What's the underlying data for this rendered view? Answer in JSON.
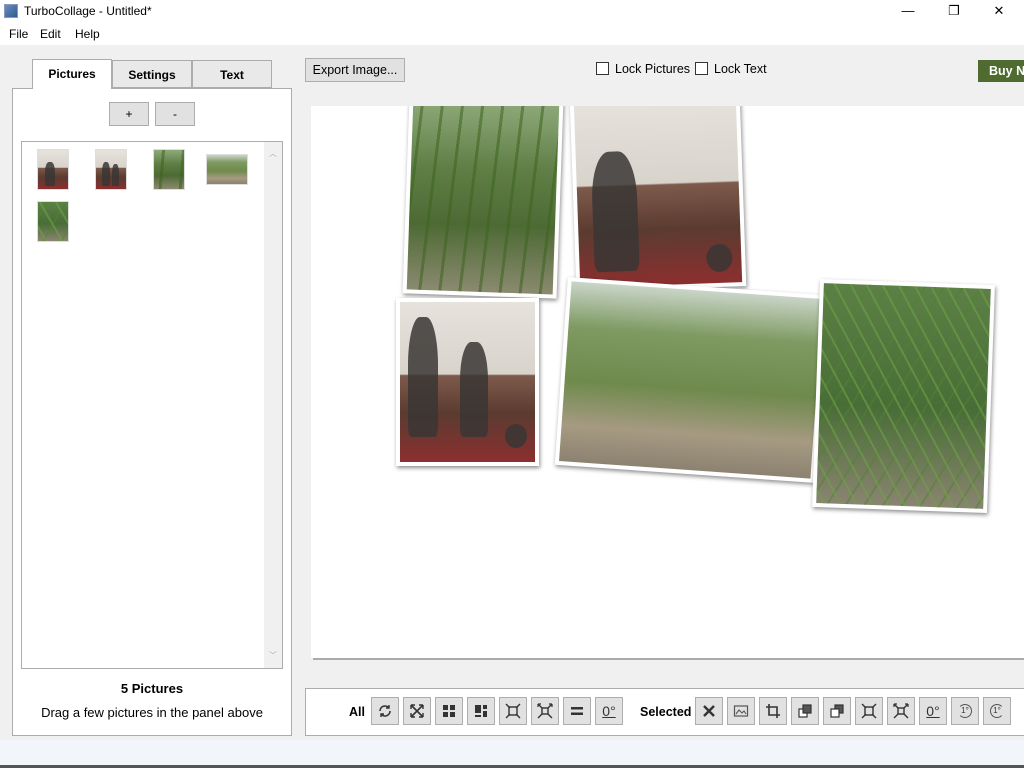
{
  "window": {
    "title": "TurboCollage - Untitled*",
    "minimize": "—",
    "restore": "❐",
    "close": "✕"
  },
  "menu": [
    "File",
    "Edit",
    "Help"
  ],
  "tabs": [
    "Pictures",
    "Settings",
    "Text"
  ],
  "panel": {
    "add_label": "+",
    "remove_label": "-",
    "picture_count": "5 Pictures",
    "hint": "Drag a few pictures in the panel above"
  },
  "top": {
    "export_label": "Export Image...",
    "lock_pictures": "Lock Pictures",
    "lock_text": "Lock Text",
    "buy_label": "Buy Now"
  },
  "toolbar": {
    "all_label": "All",
    "selected_label": "Selected",
    "all_tools": [
      "shuffle-icon",
      "fit-all-icon",
      "grid-icon",
      "mosaic-icon",
      "expand-icon",
      "shrink-icon",
      "equal-icon",
      "zero-rotation-icon"
    ],
    "selected_tools": [
      "delete-icon",
      "image-icon",
      "crop-icon",
      "bring-forward-icon",
      "send-backward-icon",
      "expand-icon",
      "shrink-icon",
      "zero-rotation-icon",
      "rotate-left-icon",
      "rotate-right-icon"
    ],
    "zero_label": "0°",
    "rotate_left_label": "1°",
    "rotate_right_label": "1°"
  },
  "thumbnails": [
    "room-photo-1",
    "room-photo-2",
    "bamboo-photo-1",
    "garden-photo",
    "bamboo-photo-2"
  ],
  "colors": {
    "buy_button": "#4f6b30",
    "panel_border": "#acacac"
  }
}
